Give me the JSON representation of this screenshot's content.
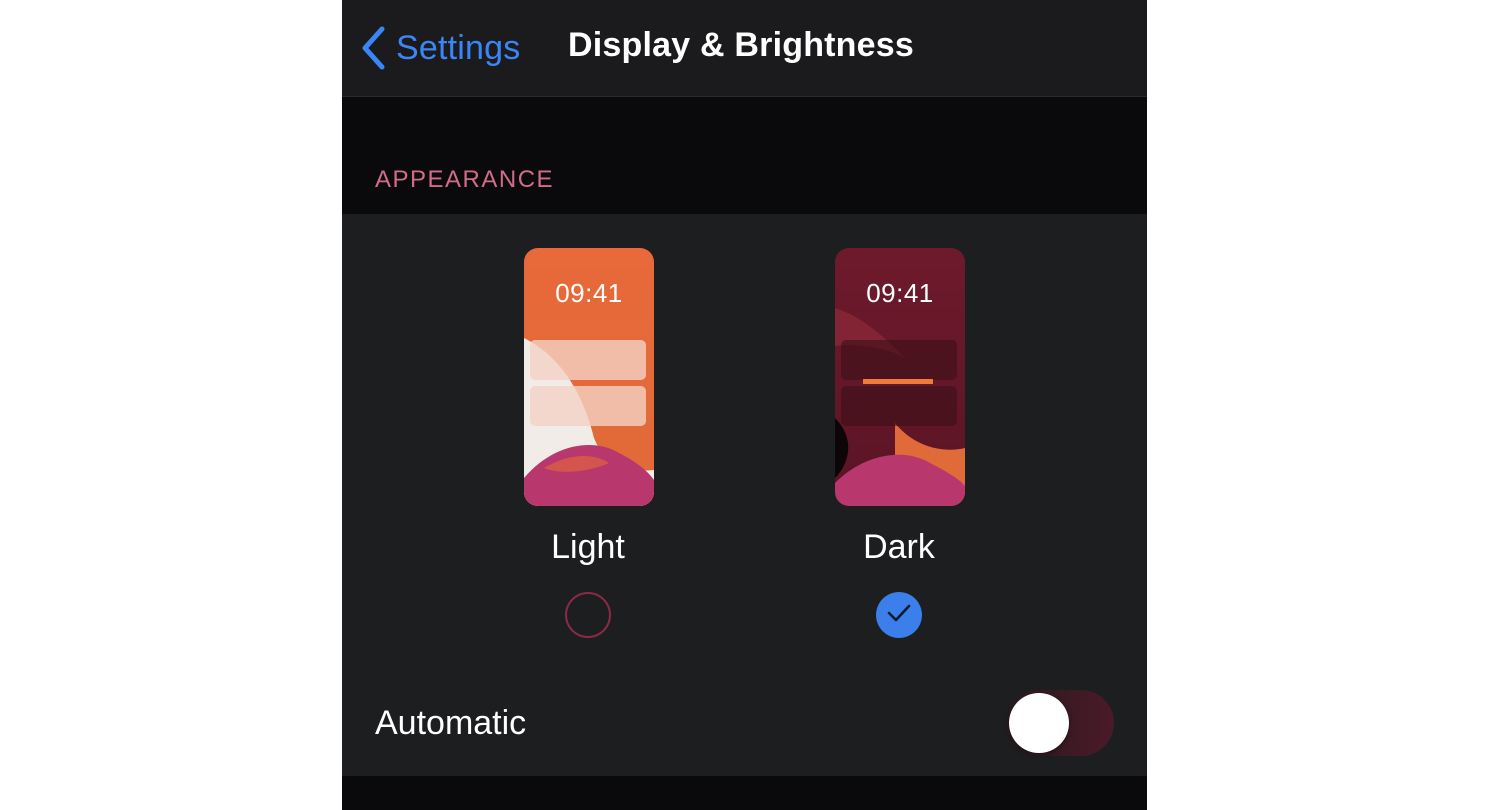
{
  "navbar": {
    "back_label": "Settings",
    "title": "Display & Brightness"
  },
  "appearance": {
    "section_header": "APPEARANCE",
    "options": [
      {
        "label": "Light",
        "time": "09:41",
        "selected": false
      },
      {
        "label": "Dark",
        "time": "09:41",
        "selected": true
      }
    ],
    "automatic": {
      "label": "Automatic",
      "enabled": false
    }
  },
  "colors": {
    "accent": "#3b86f7",
    "section_header": "#d06c86",
    "background": "#0a0a0c",
    "group_background": "#1c1e20"
  }
}
